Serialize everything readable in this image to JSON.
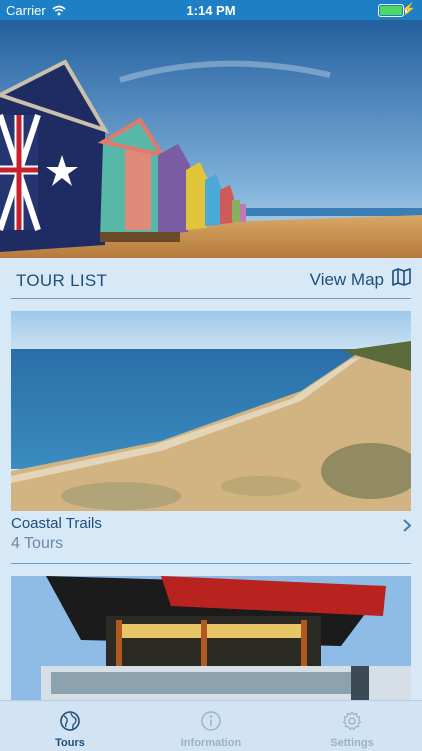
{
  "status_bar": {
    "carrier": "Carrier",
    "time": "1:14 PM"
  },
  "hero": {
    "image": "beach-huts-photo"
  },
  "tour_list": {
    "title": "TOUR LIST",
    "view_map_label": "View Map"
  },
  "tours": [
    {
      "title": "Coastal Trails",
      "count": "4 Tours",
      "image": "coastal-beach-photo"
    },
    {
      "title": "",
      "count": "",
      "image": "modern-building-photo"
    }
  ],
  "tab_bar": {
    "items": [
      {
        "label": "Tours",
        "icon": "globe-icon",
        "active": true
      },
      {
        "label": "Information",
        "icon": "info-icon",
        "active": false
      },
      {
        "label": "Settings",
        "icon": "gear-icon",
        "active": false
      }
    ]
  },
  "colors": {
    "accent": "#1e4f7a",
    "status_bar": "#1d7fc4",
    "background": "#d7e8f7",
    "inactive": "#9bb2c6"
  }
}
